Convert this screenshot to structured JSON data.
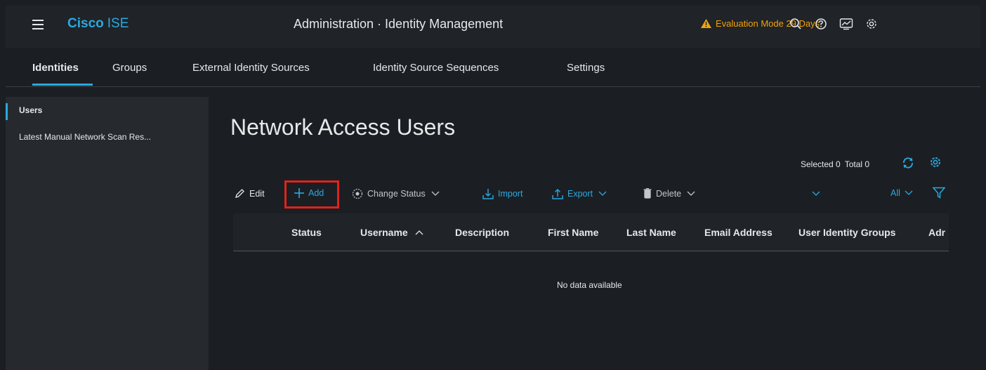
{
  "header": {
    "brand_primary": "Cisco",
    "brand_secondary": "ISE",
    "title": "Administration · Identity Management",
    "evaluation": "Evaluation Mode 29 Days",
    "icons": [
      "search-icon",
      "help-icon",
      "dashboard-icon",
      "settings-icon"
    ]
  },
  "tabs": [
    {
      "label": "Identities",
      "active": true
    },
    {
      "label": "Groups"
    },
    {
      "label": "External Identity Sources"
    },
    {
      "label": "Identity Source Sequences"
    },
    {
      "label": "Settings"
    }
  ],
  "sidebar": {
    "items": [
      {
        "label": "Users",
        "active": true
      },
      {
        "label": "Latest Manual Network Scan Res..."
      }
    ]
  },
  "main": {
    "title": "Network Access Users",
    "selected_label": "Selected 0",
    "total_label": "Total 0",
    "toolbar": {
      "edit": "Edit",
      "add": "Add",
      "change_status": "Change Status",
      "import": "Import",
      "export": "Export",
      "delete": "Delete",
      "filter_all": "All"
    },
    "columns": [
      "Status",
      "Username",
      "Description",
      "First Name",
      "Last Name",
      "Email Address",
      "User Identity Groups",
      "Adr"
    ],
    "empty_text": "No data available"
  },
  "colors": {
    "accent": "#2aa9e0",
    "warning": "#f2a20c",
    "highlight": "#e0231b"
  }
}
